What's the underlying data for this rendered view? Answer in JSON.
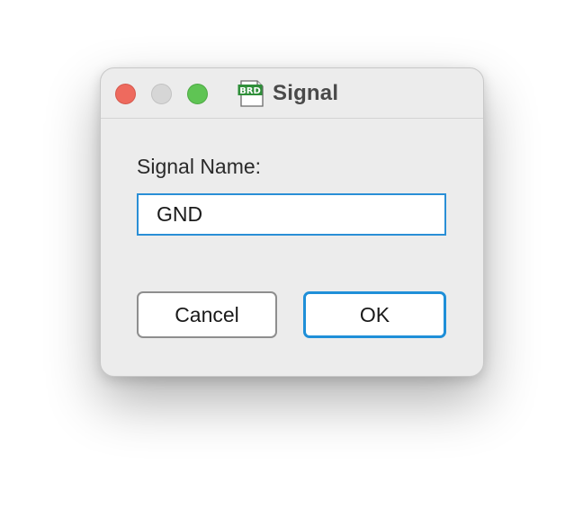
{
  "window": {
    "title": "Signal",
    "icon": "brd-document-icon",
    "icon_text": "BRD"
  },
  "form": {
    "label": "Signal Name:",
    "value": "GND"
  },
  "buttons": {
    "cancel_label": "Cancel",
    "ok_label": "OK"
  },
  "colors": {
    "close": "#ee6a5e",
    "minimize": "#d6d6d6",
    "zoom": "#5fc454",
    "focus_ring": "#2a8fd6",
    "icon_green": "#2f8f3a"
  }
}
